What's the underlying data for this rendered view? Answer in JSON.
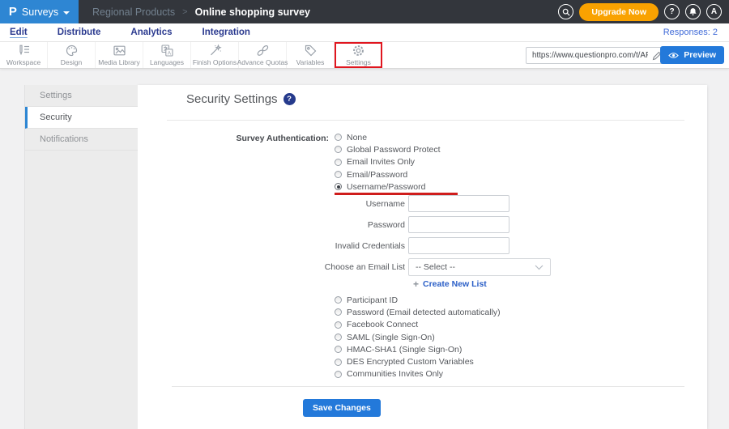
{
  "topbar": {
    "logo_letter": "P",
    "product_label": "Surveys",
    "breadcrumb": {
      "parent": "Regional Products",
      "separator": ">",
      "current": "Online shopping survey"
    },
    "upgrade_label": "Upgrade Now",
    "help_glyph": "?",
    "avatar_letter": "A"
  },
  "nav": {
    "items": [
      "Edit",
      "Distribute",
      "Analytics",
      "Integration"
    ],
    "active": "Edit",
    "responses": "Responses: 2"
  },
  "toolbar": {
    "items": [
      {
        "label": "Workspace",
        "icon": "workspace-icon"
      },
      {
        "label": "Design",
        "icon": "design-palette-icon"
      },
      {
        "label": "Media Library",
        "icon": "media-image-icon"
      },
      {
        "label": "Languages",
        "icon": "languages-translate-icon"
      },
      {
        "label": "Finish Options",
        "icon": "finish-wand-icon"
      },
      {
        "label": "Advance Quotas",
        "icon": "quotas-chain-icon"
      },
      {
        "label": "Variables",
        "icon": "variables-tag-icon"
      },
      {
        "label": "Settings",
        "icon": "settings-gear-icon",
        "highlighted": true
      }
    ],
    "url_value": "https://www.questionpro.com/t/APNrFZ",
    "preview_label": "Preview"
  },
  "sidebar": {
    "items": [
      {
        "label": "Settings",
        "active": false
      },
      {
        "label": "Security",
        "active": true
      },
      {
        "label": "Notifications",
        "active": false
      }
    ]
  },
  "main": {
    "title": "Security Settings",
    "help_glyph": "?",
    "auth_label": "Survey Authentication:",
    "auth_options_top": [
      "None",
      "Global Password Protect",
      "Email Invites Only",
      "Email/Password",
      "Username/Password"
    ],
    "selected_option": "Username/Password",
    "fields": {
      "username": {
        "label": "Username",
        "value": ""
      },
      "password": {
        "label": "Password",
        "value": ""
      },
      "invalid_credentials": {
        "label": "Invalid Credentials",
        "value": ""
      }
    },
    "email_list": {
      "label": "Choose an Email List",
      "value": "-- Select --"
    },
    "create_link": "Create New List",
    "create_plus": "+",
    "auth_options_bottom": [
      "Participant ID",
      "Password (Email detected automatically)",
      "Facebook Connect",
      "SAML (Single Sign-On)",
      "HMAC-SHA1 (Single Sign-On)",
      "DES Encrypted Custom Variables",
      "Communities Invites Only"
    ],
    "save_label": "Save Changes"
  },
  "colors": {
    "topbar_bg": "#33363c",
    "brand_blue": "#2e86d3",
    "upgrade_orange": "#f9a201",
    "nav_navy": "#2b3a8f",
    "responses_blue": "#3f6ad8",
    "link_blue": "#2b5fc7",
    "action_blue": "#2379da",
    "annotation_red": "#e0161f",
    "help_navy": "#253a8c"
  }
}
